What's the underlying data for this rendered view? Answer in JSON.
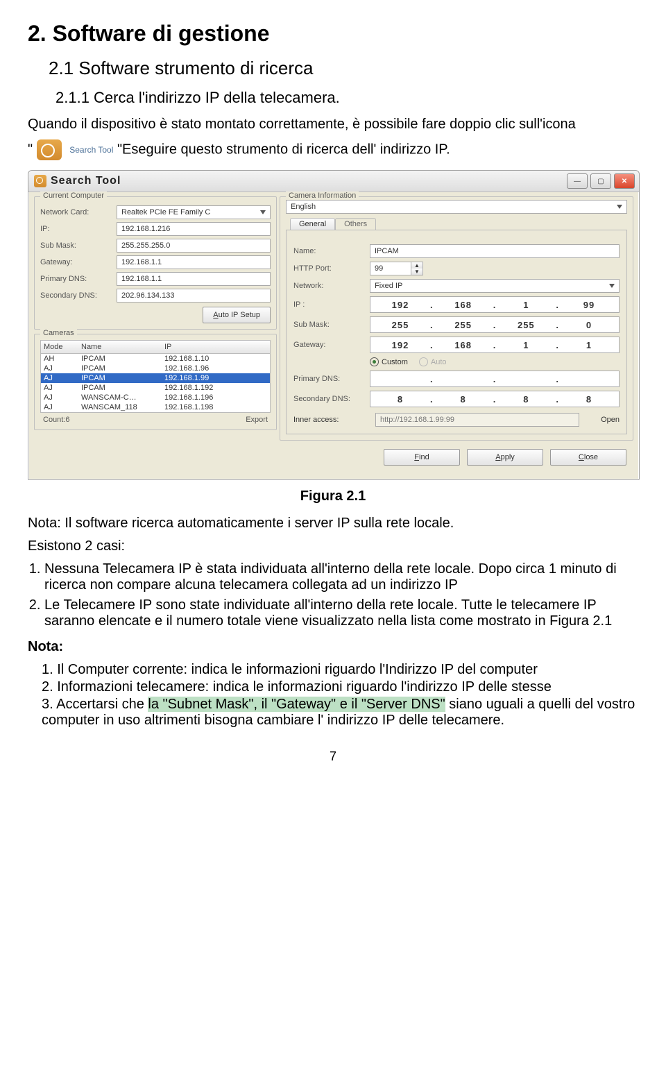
{
  "doc": {
    "h1": "2. Software di gestione",
    "h2": "2.1 Software strumento di ricerca",
    "h3": "2.1.1 Cerca l'indirizzo IP della telecamera.",
    "para1a": "Quando il dispositivo è stato montato correttamente, è possibile fare doppio clic sull'icona",
    "para1b": "\"Eseguire questo strumento di ricerca dell' indirizzo IP.",
    "quote_open": "\"",
    "search_tool_label": "Search Tool",
    "caption": "Figura 2.1",
    "note1": "Nota: Il software ricerca automaticamente i server IP sulla rete locale.",
    "cases_intro": "Esistono 2 casi:",
    "cases": [
      "Nessuna Telecamera IP è stata individuata all'interno della rete locale. Dopo circa 1 minuto di ricerca non compare alcuna telecamera collegata ad un indirizzo IP",
      "Le Telecamere IP sono state individuate all'interno della rete locale. Tutte le telecamere IP saranno elencate e il numero totale viene visualizzato nella lista come mostrato in Figura 2.1"
    ],
    "note2_title": "Nota:",
    "note2_items": [
      "1. Il Computer corrente:  indica le informazioni riguardo l'Indirizzo IP del computer",
      "2. Informazioni telecamere: indica le informazioni riguardo l'indirizzo IP delle stesse"
    ],
    "note2_item3_pre": "3. Accertarsi che ",
    "note2_item3_hl": "la \"Subnet Mask\", il \"Gateway\" e il \"Server DNS\"",
    "note2_item3_post": " siano uguali a quelli del vostro computer in uso altrimenti bisogna cambiare l' indirizzo IP delle telecamere.",
    "pagenum": "7"
  },
  "win": {
    "title": "Search Tool",
    "lang": "English",
    "sections": {
      "current_computer": "Current Computer",
      "cameras": "Cameras",
      "camera_info": "Camera Information"
    },
    "left": {
      "labels": {
        "network_card": "Network Card:",
        "ip": "IP:",
        "sub_mask": "Sub Mask:",
        "gateway": "Gateway:",
        "primary_dns": "Primary DNS:",
        "secondary_dns": "Secondary DNS:"
      },
      "values": {
        "network_card": "Realtek PCIe FE Family C",
        "ip": "192.168.1.216",
        "sub_mask": "255.255.255.0",
        "gateway": "192.168.1.1",
        "primary_dns": "192.168.1.1",
        "secondary_dns": "202.96.134.133"
      },
      "auto_btn_label": "Auto IP Setup"
    },
    "cameras": {
      "cols": {
        "mode": "Mode",
        "name": "Name",
        "ip": "IP"
      },
      "rows": [
        {
          "mode": "AH",
          "name": "IPCAM",
          "ip": "192.168.1.10"
        },
        {
          "mode": "AJ",
          "name": "IPCAM",
          "ip": "192.168.1.96"
        },
        {
          "mode": "AJ",
          "name": "IPCAM",
          "ip": "192.168.1.99"
        },
        {
          "mode": "AJ",
          "name": "IPCAM",
          "ip": "192.168.1.192"
        },
        {
          "mode": "AJ",
          "name": "WANSCAM-C…",
          "ip": "192.168.1.196"
        },
        {
          "mode": "AJ",
          "name": "WANSCAM_118",
          "ip": "192.168.1.198"
        }
      ],
      "selected_index": 2,
      "count_label": "Count:6",
      "export_label": "Export"
    },
    "tabs": {
      "general": "General",
      "others": "Others"
    },
    "right": {
      "labels": {
        "name": "Name:",
        "http_port": "HTTP Port:",
        "network": "Network:",
        "ip": "IP  :",
        "sub_mask": "Sub Mask:",
        "gateway": "Gateway:",
        "primary_dns": "Primary DNS:",
        "secondary_dns": "Secondary DNS:",
        "inner_access": "Inner access:"
      },
      "values": {
        "name": "IPCAM",
        "http_port": "99",
        "network": "Fixed IP",
        "ip": [
          "192",
          "168",
          "1",
          "99"
        ],
        "sub_mask": [
          "255",
          "255",
          "255",
          "0"
        ],
        "gateway": [
          "192",
          "168",
          "1",
          "1"
        ],
        "primary_dns": [
          "",
          "",
          "",
          ""
        ],
        "secondary_dns": [
          "8",
          "8",
          "8",
          "8"
        ],
        "inner_access": "http://192.168.1.99:99"
      },
      "radio": {
        "custom": "Custom",
        "auto": "Auto"
      },
      "open_label": "Open"
    },
    "buttons": {
      "find": "Find",
      "apply": "Apply",
      "close": "Close"
    }
  }
}
